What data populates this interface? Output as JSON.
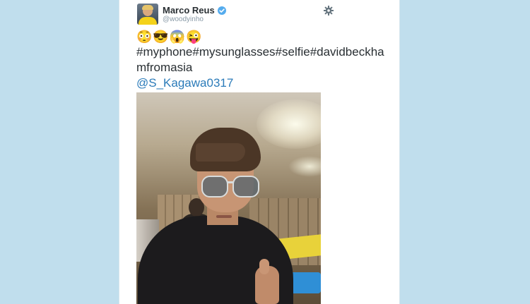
{
  "tweet": {
    "author_name": "Marco Reus",
    "author_handle": "@woodyinho",
    "emojis": "😳😎😱😜",
    "text": "#myphone#mysunglasses#selfie#davidbeckhamfromasia",
    "mention": "@S_Kagawa0317"
  },
  "icons": {
    "verified": "verified-badge-icon",
    "settings": "gear-icon"
  },
  "colors": {
    "background": "#c0deed",
    "link": "#2b7bb9",
    "verified": "#55acee"
  }
}
